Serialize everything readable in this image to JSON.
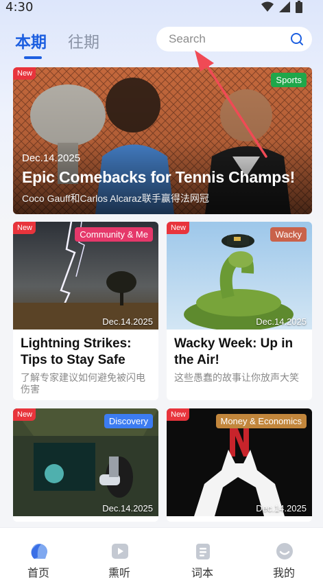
{
  "status_bar": {
    "time": "4:30"
  },
  "header": {
    "tabs": [
      {
        "label": "本期",
        "active": true
      },
      {
        "label": "往期",
        "active": false
      }
    ],
    "search": {
      "placeholder": "Search",
      "value": ""
    }
  },
  "articles": {
    "hero": {
      "badge": "New",
      "category": "Sports",
      "date": "Dec.14.2025",
      "title": "Epic Comebacks for Tennis Champs!",
      "subtitle": "Coco Gauff和Carlos Alcaraz联手赢得法网冠"
    },
    "grid": [
      {
        "badge": "New",
        "category": "Community & Me",
        "date": "Dec.14.2025",
        "title": "Lightning Strikes: Tips to Stay Safe",
        "subtitle": "了解专家建议如何避免被闪电伤害"
      },
      {
        "badge": "New",
        "category": "Wacky",
        "date": "Dec.14.2025",
        "title": "Wacky Week: Up in the Air!",
        "subtitle": "这些愚蠢的故事让你放声大笑"
      },
      {
        "badge": "New",
        "category": "Discovery",
        "date": "Dec.14.2025",
        "title": "",
        "subtitle": ""
      },
      {
        "badge": "New",
        "category": "Money & Economics",
        "date": "Dec.14.2025",
        "title": "",
        "subtitle": ""
      }
    ]
  },
  "bottom_nav": [
    {
      "label": "首页",
      "icon": "home-icon",
      "active": true
    },
    {
      "label": "熏听",
      "icon": "play-icon",
      "active": false
    },
    {
      "label": "词本",
      "icon": "notebook-icon",
      "active": false
    },
    {
      "label": "我的",
      "icon": "profile-icon",
      "active": false
    }
  ],
  "colors": {
    "accent": "#1d5fe0",
    "new_badge": "#e8343c",
    "sports": "#1fa74a",
    "community": "#e5386a",
    "wacky": "#c9624a",
    "discovery": "#3c7cf2",
    "money": "#c2863c",
    "annotation_arrow": "#f04a55"
  }
}
